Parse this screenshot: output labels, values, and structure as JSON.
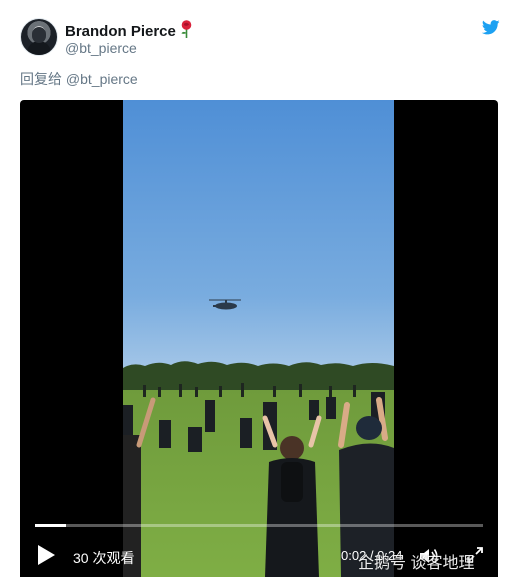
{
  "tweet": {
    "author_name": "Brandon Pierce",
    "author_handle": "@bt_pierce",
    "name_emoji": "rose-icon",
    "reply_prefix": "回复给",
    "reply_handle": "@bt_pierce",
    "platform_icon": "twitter-bird-icon"
  },
  "video": {
    "view_count": "30 次观看",
    "time_display": "0:02 / 0:24",
    "progress": 0.07,
    "controls": [
      "play-icon",
      "volume-icon",
      "fullscreen-icon"
    ]
  },
  "watermark": "企鹅号 谈客地理",
  "colors": {
    "twitter_blue": "#1DA1F2",
    "name_text": "#14171A",
    "secondary_text": "#657786",
    "rose_red": "#D9203A"
  }
}
